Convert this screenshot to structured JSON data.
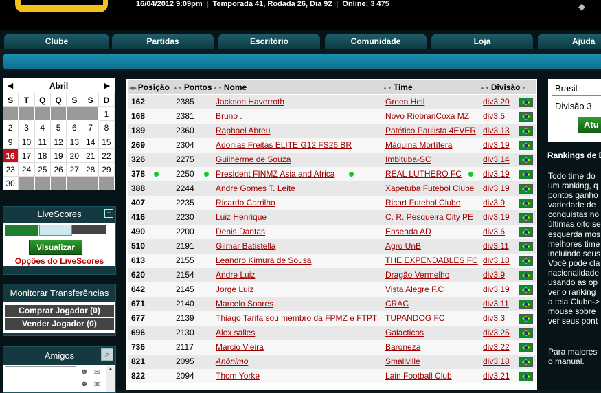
{
  "header": {
    "datetime": "16/04/2012 9:09pm",
    "season": "Temporada 41, Rodada 26, Dia 92",
    "online": "Online: 3 475"
  },
  "nav": {
    "tabs": [
      "Clube",
      "Partidas",
      "Escritório",
      "Comunidade",
      "Loja",
      "Ajuda"
    ]
  },
  "calendar": {
    "month": "Abril",
    "prev": "◀",
    "next": "▶",
    "weekdays": [
      "S",
      "T",
      "Q",
      "Q",
      "S",
      "S",
      "D"
    ],
    "today": "16",
    "days": [
      "",
      "",
      "",
      "",
      "",
      "",
      "1",
      "2",
      "3",
      "4",
      "5",
      "6",
      "7",
      "8",
      "9",
      "10",
      "11",
      "12",
      "13",
      "14",
      "15",
      "16",
      "17",
      "18",
      "19",
      "20",
      "21",
      "22",
      "23",
      "24",
      "25",
      "26",
      "27",
      "28",
      "29",
      "30",
      "",
      "",
      "",
      "",
      "",
      ""
    ]
  },
  "livescores": {
    "title": "LiveScores",
    "button": "Visualizar",
    "options": "Opções do LiveScores"
  },
  "transfers": {
    "title": "Monitorar Transferências",
    "buy": "Comprar Jogador (0)",
    "sell": "Vender Jogador (0)"
  },
  "friends": {
    "title": "Amigos"
  },
  "ranking_table": {
    "columns": [
      "Posição",
      "Pontos",
      "Nome",
      "Time",
      "Divisão"
    ],
    "rows": [
      {
        "pos": "162",
        "pts": "2385",
        "name": "Jackson Haverroth",
        "team": "Green Hell",
        "div": "div3.20"
      },
      {
        "pos": "168",
        "pts": "2381",
        "name": "Bruno .",
        "team": "Novo RiobranCoxa MZ",
        "div": "div3.5"
      },
      {
        "pos": "189",
        "pts": "2360",
        "name": "Raphael Abreu",
        "team": "Patético Paulista 4EVER",
        "div": "div3.13"
      },
      {
        "pos": "269",
        "pts": "2304",
        "name": "Adonias Freitas ELITE G12 FS26 BR",
        "team": "Máquina Mortífera",
        "div": "div3.19"
      },
      {
        "pos": "326",
        "pts": "2275",
        "name": "Guilherme de Souza",
        "team": "Imbituba-SC",
        "div": "div3.14"
      },
      {
        "pos": "378",
        "pts": "2250",
        "name": "President FINMZ Asia and Africa",
        "team": "REAL LUTHERO FC",
        "div": "div3.19",
        "online": true
      },
      {
        "pos": "388",
        "pts": "2244",
        "name": "Andre Gomes T. Leite",
        "team": "Xapetuba Futebol Clube",
        "div": "div3.19"
      },
      {
        "pos": "407",
        "pts": "2235",
        "name": "Ricardo Carrilho",
        "team": "Ricart Futebol Clube",
        "div": "div3.9"
      },
      {
        "pos": "416",
        "pts": "2230",
        "name": "Luiz Henrique",
        "team": "C. R. Pesqueira City PE",
        "div": "div3.19"
      },
      {
        "pos": "490",
        "pts": "2200",
        "name": "Denis Dantas",
        "team": "Enseada AD",
        "div": "div3.6"
      },
      {
        "pos": "510",
        "pts": "2191",
        "name": "Gilmar Batistella",
        "team": "Agro UnB",
        "div": "div3.11"
      },
      {
        "pos": "613",
        "pts": "2155",
        "name": "Leandro Kimura de Sousa",
        "team": "THE EXPENDABLES FC",
        "div": "div3.18"
      },
      {
        "pos": "620",
        "pts": "2154",
        "name": "Andre Luiz",
        "team": "Dragão Vermelho",
        "div": "div3.9"
      },
      {
        "pos": "642",
        "pts": "2145",
        "name": "Jorge Luiz",
        "team": "Vista Alegre F.C",
        "div": "div3.19"
      },
      {
        "pos": "671",
        "pts": "2140",
        "name": "Marcelo Soares",
        "team": "CRAC",
        "div": "div3.11"
      },
      {
        "pos": "677",
        "pts": "2139",
        "name": "Thiago Tarifa sou membro da FPMZ e FTPT",
        "team": "TUPANDOG FC",
        "div": "div3.3"
      },
      {
        "pos": "696",
        "pts": "2130",
        "name": "Alex salles",
        "team": "Galacticos",
        "div": "div3.25"
      },
      {
        "pos": "736",
        "pts": "2117",
        "name": "Marcio Vieira",
        "team": "Baroneza",
        "div": "div3.22"
      },
      {
        "pos": "821",
        "pts": "2095",
        "name": "Anônimo",
        "team": "Smallville",
        "div": "div3.18",
        "italic": true
      },
      {
        "pos": "822",
        "pts": "2094",
        "name": "Thom Yorke",
        "team": "Lain Football Club",
        "div": "div3.21"
      }
    ]
  },
  "filters": {
    "country": "Brasil",
    "division": "Divisão 3",
    "update_button": "Atu"
  },
  "rankings_info": {
    "title": "Rankings de D",
    "lines": [
      "Todo time do",
      "um ranking, q",
      "pontos ganho",
      "variedade de",
      "conquistas no",
      "últimas oito se",
      "esquerda mos",
      "melhores time",
      "incluindo seus",
      "Você pode cla",
      "nacionalidade",
      "usando as op",
      "ver o ranking",
      "a tela Clube->",
      "mouse sobre",
      "ver seus pont"
    ],
    "lines2": [
      "Para maiores",
      "o manual."
    ]
  }
}
